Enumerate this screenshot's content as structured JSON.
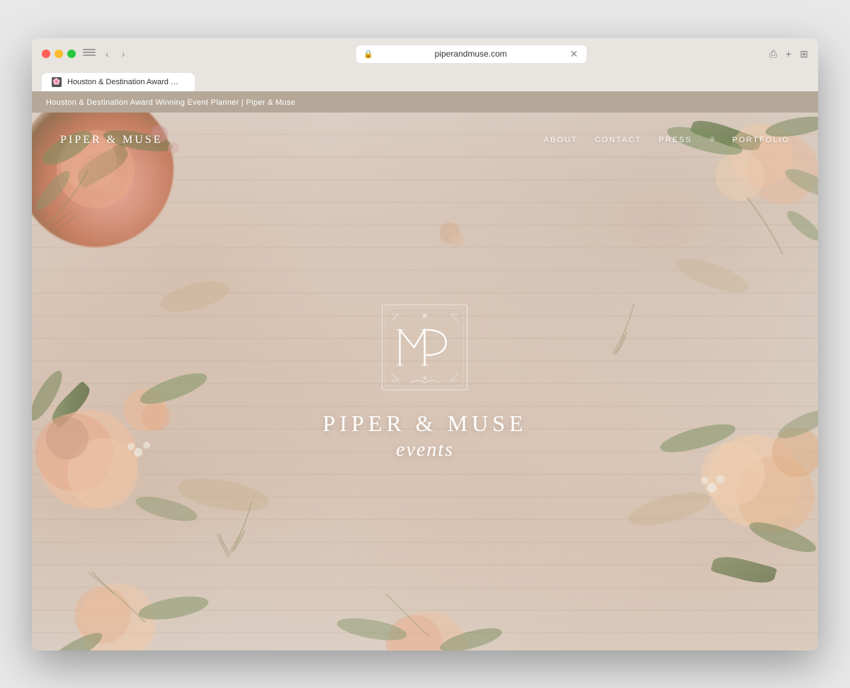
{
  "browser": {
    "url": "piperandmuse.com",
    "tab_title": "Houston & Destination Award Winning Event Planner | Piper & Muse",
    "tab_favicon": "🌸"
  },
  "topbar": {
    "text": "Houston & Destination Award Winning Event Planner | Piper & Muse"
  },
  "nav": {
    "logo": "PIPER & MUSE",
    "links": [
      {
        "label": "ABOUT"
      },
      {
        "label": "CONTACT"
      },
      {
        "label": "PRESS"
      },
      {
        "label": "❊"
      },
      {
        "label": "PORTFOLIO"
      }
    ]
  },
  "hero": {
    "brand_name": "PIPER & MUSE",
    "brand_sub": "events"
  },
  "icons": {
    "lock": "🔒",
    "back": "‹",
    "forward": "›",
    "share": "⎙",
    "new_tab": "+",
    "grid": "⊞"
  }
}
